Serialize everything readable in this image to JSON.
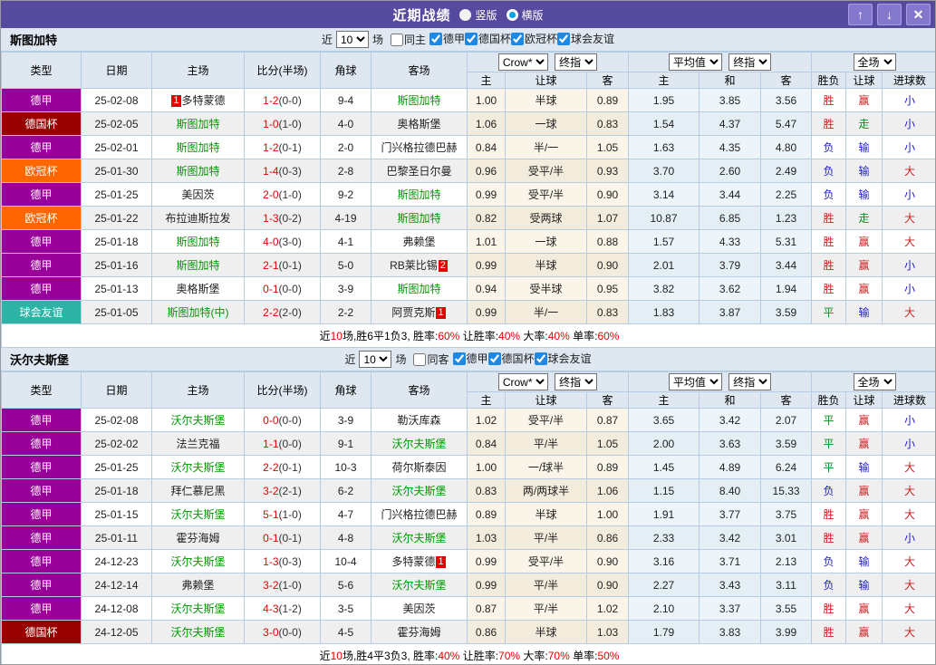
{
  "titlebar": {
    "title": "近期战绩",
    "vertical_label": "竖版",
    "horizontal_label": "横版",
    "selected_layout": "横版",
    "bg_color": "#564a9e"
  },
  "filter": {
    "near_label": "近",
    "count": "10",
    "games_label": "场"
  },
  "table_header": {
    "type": "类型",
    "date": "日期",
    "home": "主场",
    "score": "比分(半场)",
    "corner": "角球",
    "away": "客场",
    "odds_source": "Crow*",
    "odds_time": "终指",
    "avg_source": "平均值",
    "avg_time": "终指",
    "period": "全场",
    "sub": [
      "主",
      "让球",
      "客",
      "主",
      "和",
      "客",
      "胜负",
      "让球",
      "进球数"
    ]
  },
  "league_colors": {
    "德甲": "#990099",
    "德国杯": "#990000",
    "欧冠杯": "#ff6600",
    "球会友谊": "#2fb3a6"
  },
  "result_colors": {
    "r": "#cc2020",
    "g": "#089020",
    "b": "#2020cc"
  },
  "sections": [
    {
      "team": "斯图加特",
      "same_label": "同主",
      "same_checked": false,
      "leagues": [
        "德甲",
        "德国杯",
        "欧冠杯",
        "球会友谊"
      ],
      "rows": [
        {
          "league": "德甲",
          "date": "25-02-08",
          "home": {
            "name": "多特蒙德",
            "rank": "1"
          },
          "score": "1-2",
          "half": "(0-0)",
          "corner": "9-4",
          "away": {
            "name": "斯图加特",
            "self": true
          },
          "odds": [
            "1.00",
            "半球",
            "0.89"
          ],
          "avg": [
            "1.95",
            "3.85",
            "3.56"
          ],
          "outcome": [
            [
              "胜",
              "r"
            ],
            [
              "赢",
              "r"
            ],
            [
              "小",
              "b"
            ]
          ]
        },
        {
          "league": "德国杯",
          "date": "25-02-05",
          "home": {
            "name": "斯图加特",
            "self": true
          },
          "score": "1-0",
          "half": "(1-0)",
          "corner": "4-0",
          "away": {
            "name": "奥格斯堡"
          },
          "odds": [
            "1.06",
            "一球",
            "0.83"
          ],
          "avg": [
            "1.54",
            "4.37",
            "5.47"
          ],
          "outcome": [
            [
              "胜",
              "r"
            ],
            [
              "走",
              "g"
            ],
            [
              "小",
              "b"
            ]
          ]
        },
        {
          "league": "德甲",
          "date": "25-02-01",
          "home": {
            "name": "斯图加特",
            "self": true
          },
          "score": "1-2",
          "half": "(0-1)",
          "corner": "2-0",
          "away": {
            "name": "门兴格拉德巴赫"
          },
          "odds": [
            "0.84",
            "半/一",
            "1.05"
          ],
          "avg": [
            "1.63",
            "4.35",
            "4.80"
          ],
          "outcome": [
            [
              "负",
              "b"
            ],
            [
              "输",
              "b"
            ],
            [
              "小",
              "b"
            ]
          ]
        },
        {
          "league": "欧冠杯",
          "date": "25-01-30",
          "home": {
            "name": "斯图加特",
            "self": true
          },
          "score": "1-4",
          "half": "(0-3)",
          "corner": "2-8",
          "away": {
            "name": "巴黎圣日尔曼"
          },
          "odds": [
            "0.96",
            "受平/半",
            "0.93"
          ],
          "avg": [
            "3.70",
            "2.60",
            "2.49"
          ],
          "outcome": [
            [
              "负",
              "b"
            ],
            [
              "输",
              "b"
            ],
            [
              "大",
              "r"
            ]
          ]
        },
        {
          "league": "德甲",
          "date": "25-01-25",
          "home": {
            "name": "美因茨"
          },
          "score": "2-0",
          "half": "(1-0)",
          "corner": "9-2",
          "away": {
            "name": "斯图加特",
            "self": true
          },
          "odds": [
            "0.99",
            "受平/半",
            "0.90"
          ],
          "avg": [
            "3.14",
            "3.44",
            "2.25"
          ],
          "outcome": [
            [
              "负",
              "b"
            ],
            [
              "输",
              "b"
            ],
            [
              "小",
              "b"
            ]
          ]
        },
        {
          "league": "欧冠杯",
          "date": "25-01-22",
          "home": {
            "name": "布拉迪斯拉发"
          },
          "score": "1-3",
          "half": "(0-2)",
          "corner": "4-19",
          "away": {
            "name": "斯图加特",
            "self": true
          },
          "odds": [
            "0.82",
            "受两球",
            "1.07"
          ],
          "avg": [
            "10.87",
            "6.85",
            "1.23"
          ],
          "outcome": [
            [
              "胜",
              "r"
            ],
            [
              "走",
              "g"
            ],
            [
              "大",
              "r"
            ]
          ]
        },
        {
          "league": "德甲",
          "date": "25-01-18",
          "home": {
            "name": "斯图加特",
            "self": true
          },
          "score": "4-0",
          "half": "(3-0)",
          "corner": "4-1",
          "away": {
            "name": "弗赖堡"
          },
          "odds": [
            "1.01",
            "一球",
            "0.88"
          ],
          "avg": [
            "1.57",
            "4.33",
            "5.31"
          ],
          "outcome": [
            [
              "胜",
              "r"
            ],
            [
              "赢",
              "r"
            ],
            [
              "大",
              "r"
            ]
          ]
        },
        {
          "league": "德甲",
          "date": "25-01-16",
          "home": {
            "name": "斯图加特",
            "self": true
          },
          "score": "2-1",
          "half": "(0-1)",
          "corner": "5-0",
          "away": {
            "name": "RB莱比锡",
            "rank": "2"
          },
          "odds": [
            "0.99",
            "半球",
            "0.90"
          ],
          "avg": [
            "2.01",
            "3.79",
            "3.44"
          ],
          "outcome": [
            [
              "胜",
              "r"
            ],
            [
              "赢",
              "r"
            ],
            [
              "小",
              "b"
            ]
          ]
        },
        {
          "league": "德甲",
          "date": "25-01-13",
          "home": {
            "name": "奥格斯堡"
          },
          "score": "0-1",
          "half": "(0-0)",
          "corner": "3-9",
          "away": {
            "name": "斯图加特",
            "self": true
          },
          "odds": [
            "0.94",
            "受半球",
            "0.95"
          ],
          "avg": [
            "3.82",
            "3.62",
            "1.94"
          ],
          "outcome": [
            [
              "胜",
              "r"
            ],
            [
              "赢",
              "r"
            ],
            [
              "小",
              "b"
            ]
          ]
        },
        {
          "league": "球会友谊",
          "date": "25-01-05",
          "home": {
            "name": "斯图加特(中)",
            "self": true
          },
          "score": "2-2",
          "half": "(2-0)",
          "corner": "2-2",
          "away": {
            "name": "阿贾克斯",
            "rank": "1"
          },
          "odds": [
            "0.99",
            "半/一",
            "0.83"
          ],
          "avg": [
            "1.83",
            "3.87",
            "3.59"
          ],
          "outcome": [
            [
              "平",
              "g"
            ],
            [
              "输",
              "b"
            ],
            [
              "大",
              "r"
            ]
          ]
        }
      ],
      "summary": [
        [
          "近",
          "k"
        ],
        [
          "10",
          "r"
        ],
        [
          "场,胜6平1负3, 胜率:",
          "k"
        ],
        [
          "60%",
          "r"
        ],
        [
          " 让胜率:",
          "k"
        ],
        [
          "40%",
          "r"
        ],
        [
          " 大率:",
          "k"
        ],
        [
          "40%",
          "r"
        ],
        [
          " 单率:",
          "k"
        ],
        [
          "60%",
          "r"
        ]
      ]
    },
    {
      "team": "沃尔夫斯堡",
      "same_label": "同客",
      "same_checked": false,
      "leagues": [
        "德甲",
        "德国杯",
        "球会友谊"
      ],
      "rows": [
        {
          "league": "德甲",
          "date": "25-02-08",
          "home": {
            "name": "沃尔夫斯堡",
            "self": true
          },
          "score": "0-0",
          "half": "(0-0)",
          "corner": "3-9",
          "away": {
            "name": "勒沃库森"
          },
          "odds": [
            "1.02",
            "受平/半",
            "0.87"
          ],
          "avg": [
            "3.65",
            "3.42",
            "2.07"
          ],
          "outcome": [
            [
              "平",
              "g"
            ],
            [
              "赢",
              "r"
            ],
            [
              "小",
              "b"
            ]
          ]
        },
        {
          "league": "德甲",
          "date": "25-02-02",
          "home": {
            "name": "法兰克福"
          },
          "score": "1-1",
          "half": "(0-0)",
          "corner": "9-1",
          "away": {
            "name": "沃尔夫斯堡",
            "self": true
          },
          "odds": [
            "0.84",
            "平/半",
            "1.05"
          ],
          "avg": [
            "2.00",
            "3.63",
            "3.59"
          ],
          "outcome": [
            [
              "平",
              "g"
            ],
            [
              "赢",
              "r"
            ],
            [
              "小",
              "b"
            ]
          ]
        },
        {
          "league": "德甲",
          "date": "25-01-25",
          "home": {
            "name": "沃尔夫斯堡",
            "self": true
          },
          "score": "2-2",
          "half": "(0-1)",
          "corner": "10-3",
          "away": {
            "name": "荷尔斯泰因"
          },
          "odds": [
            "1.00",
            "一/球半",
            "0.89"
          ],
          "avg": [
            "1.45",
            "4.89",
            "6.24"
          ],
          "outcome": [
            [
              "平",
              "g"
            ],
            [
              "输",
              "b"
            ],
            [
              "大",
              "r"
            ]
          ]
        },
        {
          "league": "德甲",
          "date": "25-01-18",
          "home": {
            "name": "拜仁慕尼黑"
          },
          "score": "3-2",
          "half": "(2-1)",
          "corner": "6-2",
          "away": {
            "name": "沃尔夫斯堡",
            "self": true
          },
          "odds": [
            "0.83",
            "两/两球半",
            "1.06"
          ],
          "avg": [
            "1.15",
            "8.40",
            "15.33"
          ],
          "outcome": [
            [
              "负",
              "b"
            ],
            [
              "赢",
              "r"
            ],
            [
              "大",
              "r"
            ]
          ]
        },
        {
          "league": "德甲",
          "date": "25-01-15",
          "home": {
            "name": "沃尔夫斯堡",
            "self": true
          },
          "score": "5-1",
          "half": "(1-0)",
          "corner": "4-7",
          "away": {
            "name": "门兴格拉德巴赫"
          },
          "odds": [
            "0.89",
            "半球",
            "1.00"
          ],
          "avg": [
            "1.91",
            "3.77",
            "3.75"
          ],
          "outcome": [
            [
              "胜",
              "r"
            ],
            [
              "赢",
              "r"
            ],
            [
              "大",
              "r"
            ]
          ]
        },
        {
          "league": "德甲",
          "date": "25-01-11",
          "home": {
            "name": "霍芬海姆"
          },
          "score": "0-1",
          "half": "(0-1)",
          "corner": "4-8",
          "away": {
            "name": "沃尔夫斯堡",
            "self": true
          },
          "odds": [
            "1.03",
            "平/半",
            "0.86"
          ],
          "avg": [
            "2.33",
            "3.42",
            "3.01"
          ],
          "outcome": [
            [
              "胜",
              "r"
            ],
            [
              "赢",
              "r"
            ],
            [
              "小",
              "b"
            ]
          ]
        },
        {
          "league": "德甲",
          "date": "24-12-23",
          "home": {
            "name": "沃尔夫斯堡",
            "self": true
          },
          "score": "1-3",
          "half": "(0-3)",
          "corner": "10-4",
          "away": {
            "name": "多特蒙德",
            "rank": "1"
          },
          "odds": [
            "0.99",
            "受平/半",
            "0.90"
          ],
          "avg": [
            "3.16",
            "3.71",
            "2.13"
          ],
          "outcome": [
            [
              "负",
              "b"
            ],
            [
              "输",
              "b"
            ],
            [
              "大",
              "r"
            ]
          ]
        },
        {
          "league": "德甲",
          "date": "24-12-14",
          "home": {
            "name": "弗赖堡"
          },
          "score": "3-2",
          "half": "(1-0)",
          "corner": "5-6",
          "away": {
            "name": "沃尔夫斯堡",
            "self": true
          },
          "odds": [
            "0.99",
            "平/半",
            "0.90"
          ],
          "avg": [
            "2.27",
            "3.43",
            "3.11"
          ],
          "outcome": [
            [
              "负",
              "b"
            ],
            [
              "输",
              "b"
            ],
            [
              "大",
              "r"
            ]
          ]
        },
        {
          "league": "德甲",
          "date": "24-12-08",
          "home": {
            "name": "沃尔夫斯堡",
            "self": true
          },
          "score": "4-3",
          "half": "(1-2)",
          "corner": "3-5",
          "away": {
            "name": "美因茨"
          },
          "odds": [
            "0.87",
            "平/半",
            "1.02"
          ],
          "avg": [
            "2.10",
            "3.37",
            "3.55"
          ],
          "outcome": [
            [
              "胜",
              "r"
            ],
            [
              "赢",
              "r"
            ],
            [
              "大",
              "r"
            ]
          ]
        },
        {
          "league": "德国杯",
          "date": "24-12-05",
          "home": {
            "name": "沃尔夫斯堡",
            "self": true
          },
          "score": "3-0",
          "half": "(0-0)",
          "corner": "4-5",
          "away": {
            "name": "霍芬海姆"
          },
          "odds": [
            "0.86",
            "半球",
            "1.03"
          ],
          "avg": [
            "1.79",
            "3.83",
            "3.99"
          ],
          "outcome": [
            [
              "胜",
              "r"
            ],
            [
              "赢",
              "r"
            ],
            [
              "大",
              "r"
            ]
          ]
        }
      ],
      "summary": [
        [
          "近",
          "k"
        ],
        [
          "10",
          "r"
        ],
        [
          "场,胜4平3负3, 胜率:",
          "k"
        ],
        [
          "40%",
          "r"
        ],
        [
          " 让胜率:",
          "k"
        ],
        [
          "70%",
          "r"
        ],
        [
          " 大率:",
          "k"
        ],
        [
          "70%",
          "r"
        ],
        [
          " 单率:",
          "k"
        ],
        [
          "50%",
          "r"
        ]
      ]
    }
  ]
}
